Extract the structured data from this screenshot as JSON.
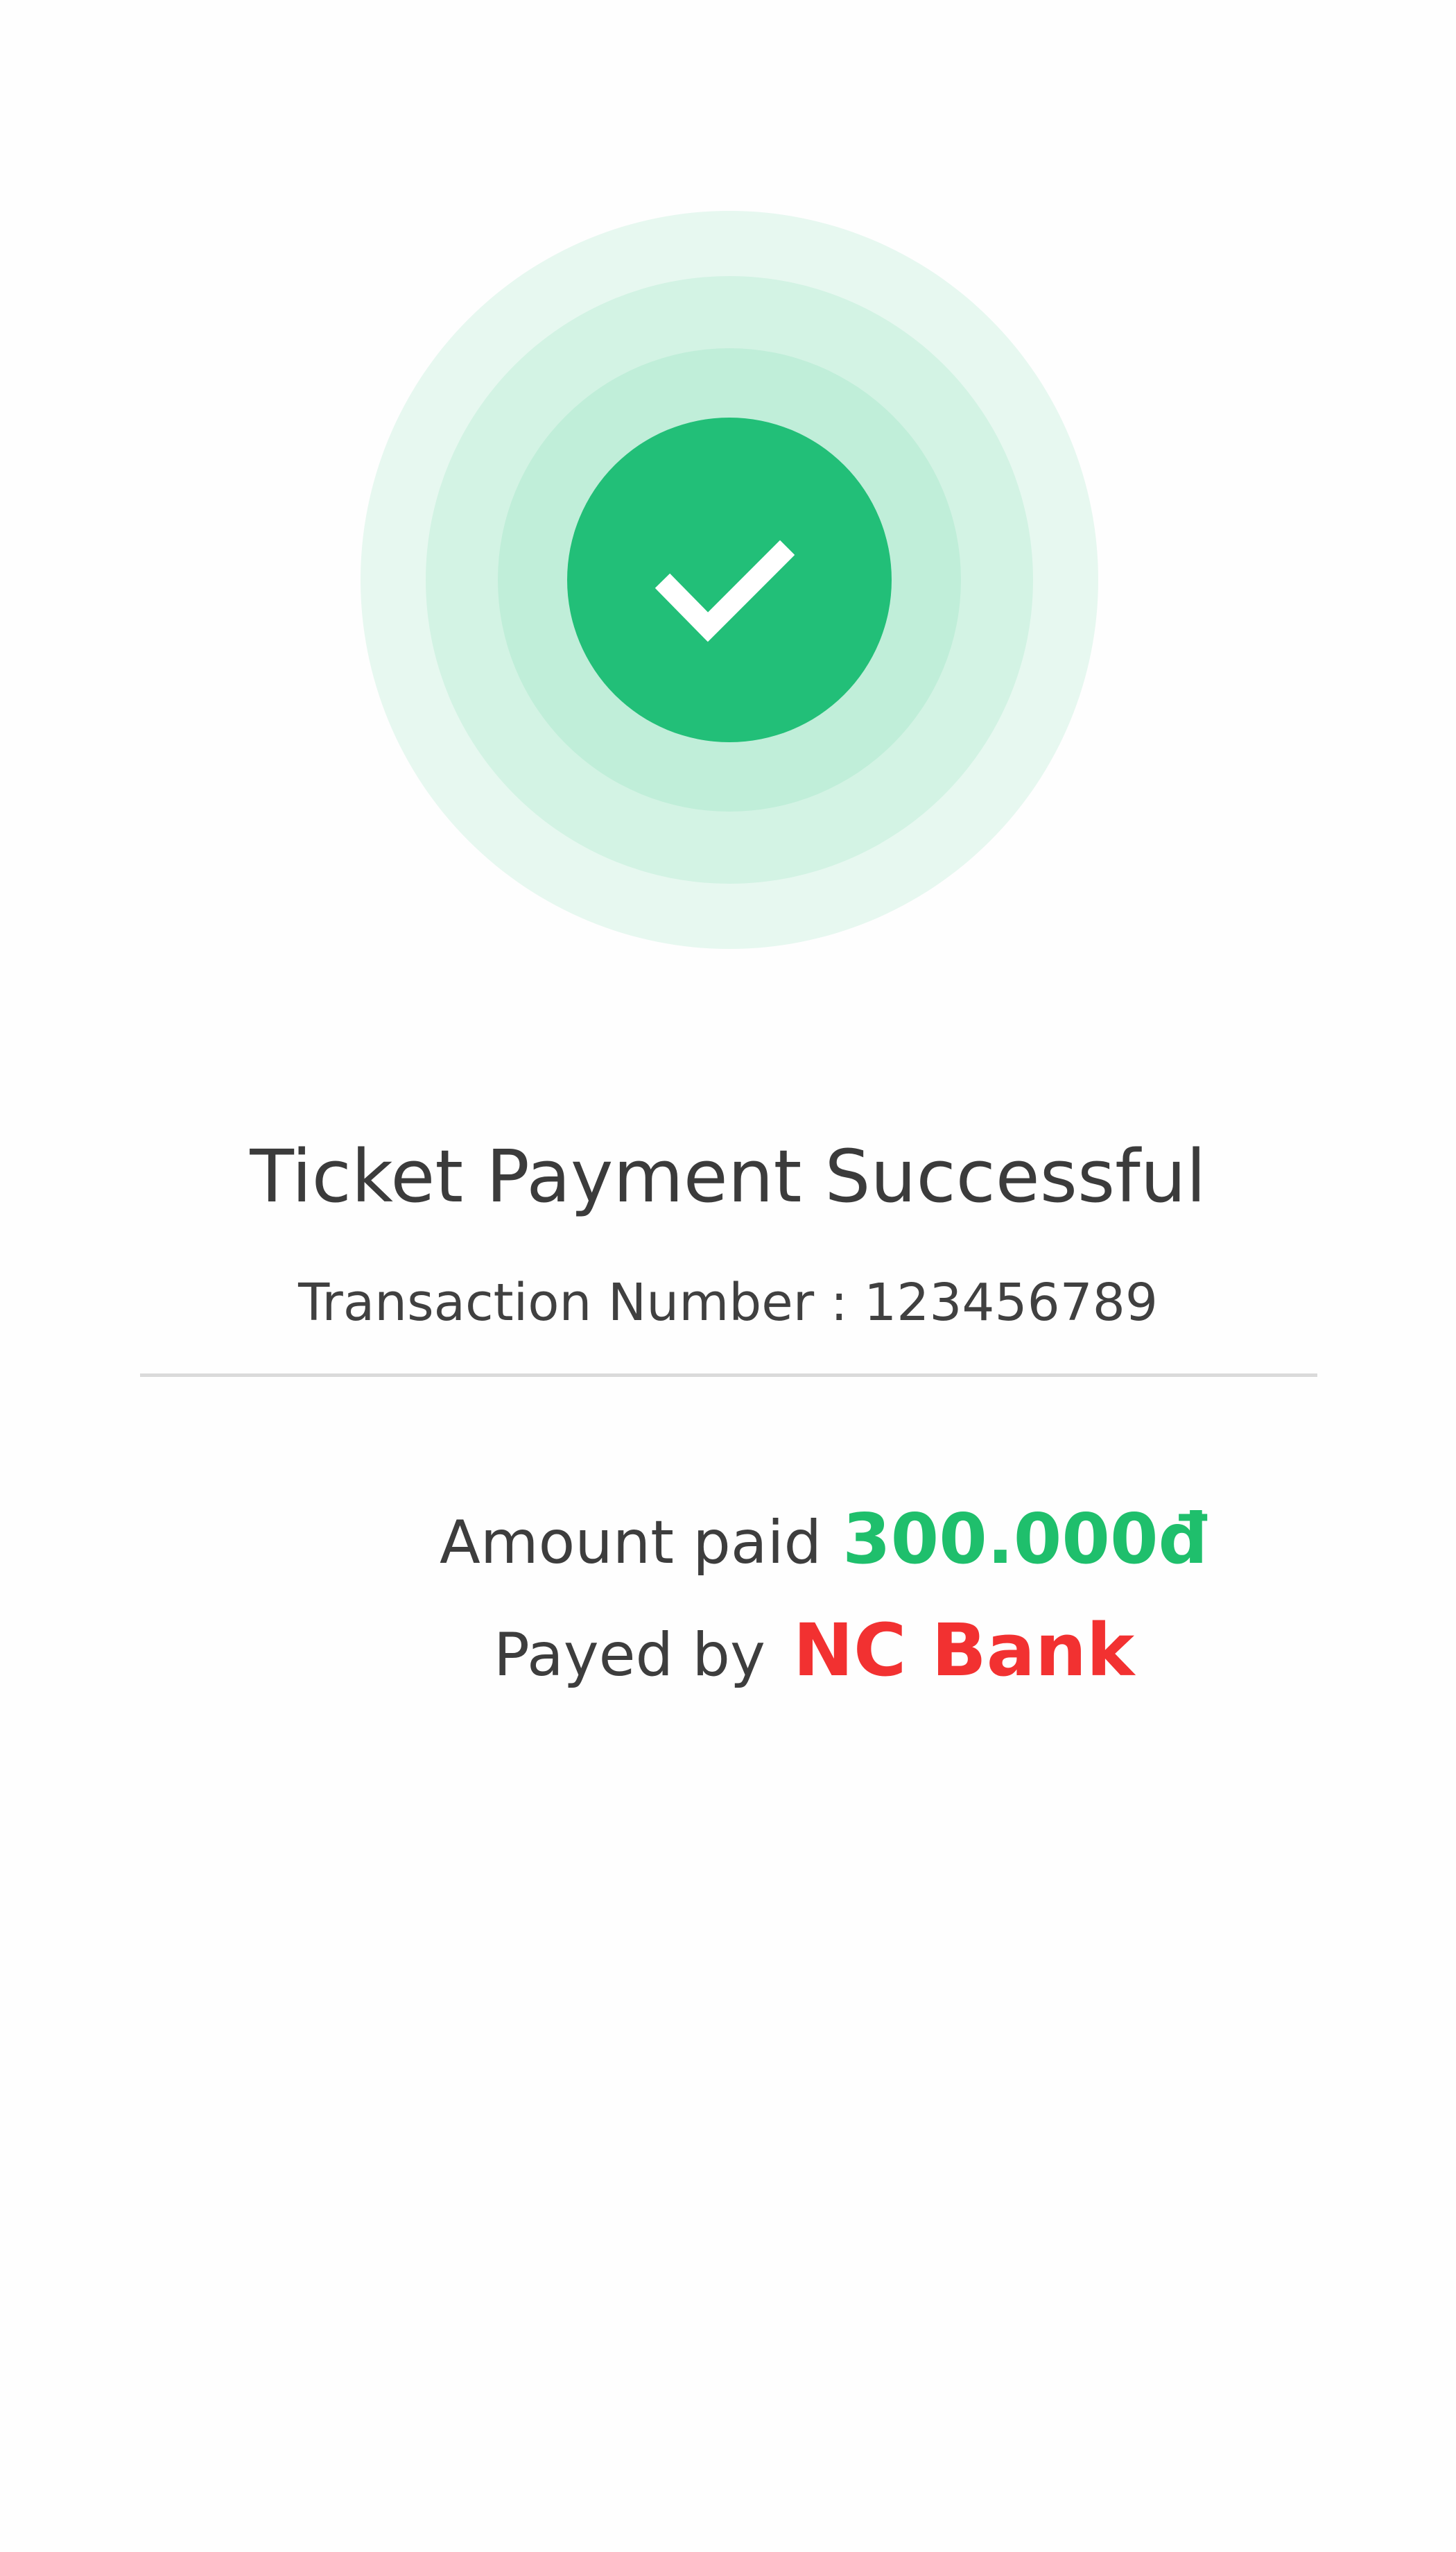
{
  "success_indicator": {
    "icon": "check-icon",
    "accent_color": "#22bf78",
    "ring_colors": [
      "#e7f8f0",
      "#d3f3e4",
      "#c0eed9"
    ]
  },
  "title": "Ticket Payment Successful",
  "transaction": {
    "text": "Transaction Number : 123456789"
  },
  "amount": {
    "label": "Amount paid",
    "value": "300.000đ",
    "color": "#1fbf6c"
  },
  "payer": {
    "label": "Payed by",
    "value": "NC Bank",
    "color": "#f23131"
  }
}
